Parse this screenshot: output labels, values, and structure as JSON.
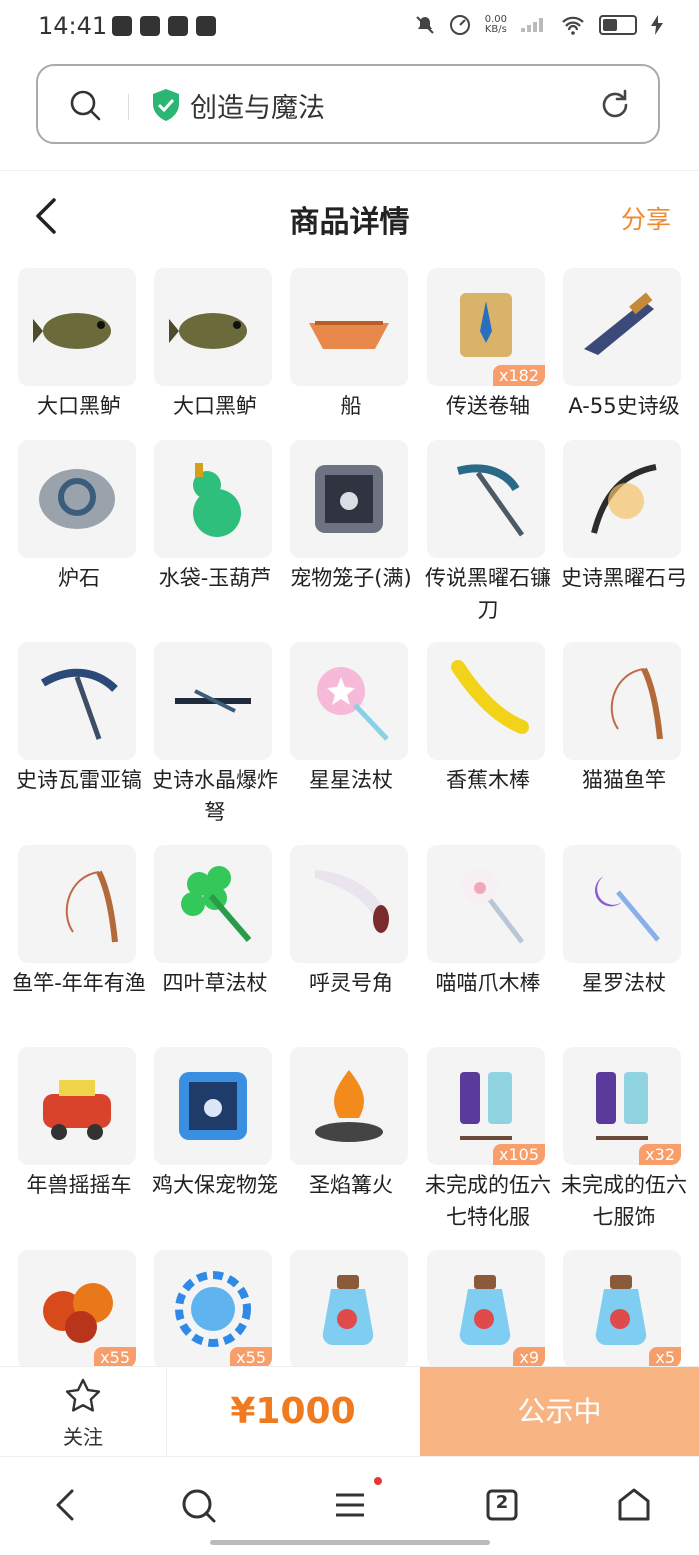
{
  "status_bar": {
    "time": "14:41",
    "net_speed": "0.00",
    "net_unit": "KB/s"
  },
  "browser": {
    "site_title": "创造与魔法"
  },
  "header": {
    "title": "商品详情",
    "share": "分享"
  },
  "items": [
    {
      "name": "大口黑鲈",
      "badge": "",
      "icon": "fish-icon"
    },
    {
      "name": "大口黑鲈",
      "badge": "",
      "icon": "fish-icon"
    },
    {
      "name": "船",
      "badge": "",
      "icon": "boat-icon"
    },
    {
      "name": "传送卷轴",
      "badge": "x182",
      "icon": "scroll-icon"
    },
    {
      "name": "A-55史诗级",
      "badge": "",
      "icon": "gun-icon"
    },
    {
      "name": "炉石",
      "badge": "",
      "icon": "hearthstone-icon"
    },
    {
      "name": "水袋-玉葫芦",
      "badge": "",
      "icon": "gourd-icon"
    },
    {
      "name": "宠物笼子(满)",
      "badge": "",
      "icon": "pet-cage-icon"
    },
    {
      "name": "传说黑曜石镰刀",
      "badge": "",
      "icon": "scythe-icon"
    },
    {
      "name": "史诗黑曜石弓",
      "badge": "",
      "icon": "bow-icon"
    },
    {
      "name": "史诗瓦雷亚镐",
      "badge": "",
      "icon": "pickaxe-icon"
    },
    {
      "name": "史诗水晶爆炸弩",
      "badge": "",
      "icon": "crossbow-icon"
    },
    {
      "name": "星星法杖",
      "badge": "",
      "icon": "star-wand-icon"
    },
    {
      "name": "香蕉木棒",
      "badge": "",
      "icon": "banana-icon"
    },
    {
      "name": "猫猫鱼竿",
      "badge": "",
      "icon": "fishing-rod-icon"
    },
    {
      "name": "鱼竿-年年有渔",
      "badge": "",
      "icon": "fishing-rod-icon"
    },
    {
      "name": "四叶草法杖",
      "badge": "",
      "icon": "clover-icon"
    },
    {
      "name": "呼灵号角",
      "badge": "",
      "icon": "horn-icon"
    },
    {
      "name": "喵喵爪木棒",
      "badge": "",
      "icon": "paw-staff-icon"
    },
    {
      "name": "星罗法杖",
      "badge": "",
      "icon": "moon-staff-icon"
    },
    {
      "name": "年兽摇摇车",
      "badge": "",
      "icon": "cart-icon"
    },
    {
      "name": "鸡大保宠物笼",
      "badge": "",
      "icon": "pet-cage-blue-icon"
    },
    {
      "name": "圣焰篝火",
      "badge": "",
      "icon": "campfire-icon"
    },
    {
      "name": "未完成的伍六七特化服",
      "badge": "x105",
      "icon": "outfit-icon"
    },
    {
      "name": "未完成的伍六七服饰",
      "badge": "x32",
      "icon": "outfit-icon"
    },
    {
      "name": "",
      "badge": "x55",
      "icon": "orb-red-icon"
    },
    {
      "name": "",
      "badge": "x55",
      "icon": "portal-blue-icon"
    },
    {
      "name": "",
      "badge": "",
      "icon": "potion-icon"
    },
    {
      "name": "",
      "badge": "x9",
      "icon": "potion-icon"
    },
    {
      "name": "",
      "badge": "x5",
      "icon": "potion-icon"
    }
  ],
  "action_bar": {
    "follow_label": "关注",
    "price": "¥1000",
    "status_label": "公示中"
  },
  "nav": {
    "tab_count": "2"
  },
  "colors": {
    "accent": "#f07a1f",
    "status_button": "#f9b483",
    "badge": "#f79e6a",
    "shield": "#2bb673"
  }
}
